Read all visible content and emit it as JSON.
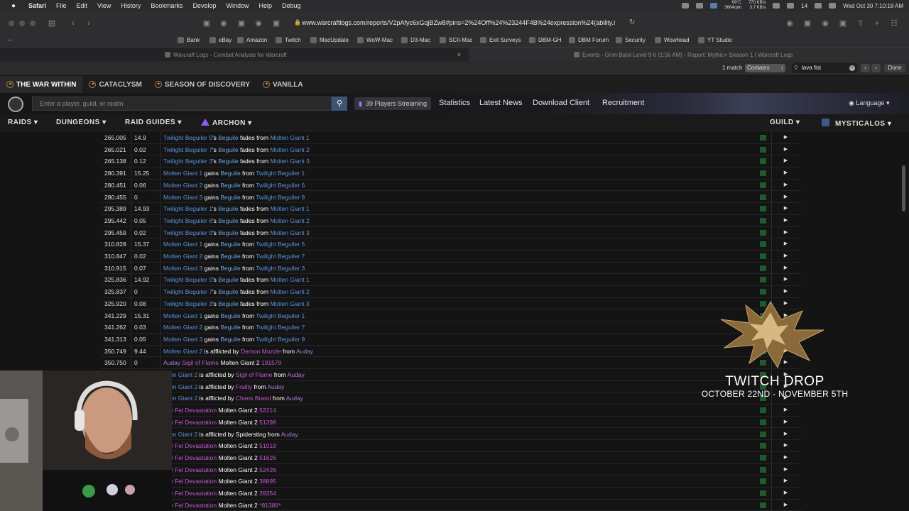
{
  "menubar": {
    "app": "Safari",
    "items": [
      "File",
      "Edit",
      "View",
      "History",
      "Bookmarks",
      "Develop",
      "Window",
      "Help",
      "Debug"
    ],
    "temp": "69°C",
    "rpm": "3664rpm",
    "net_up": "770 KB/s",
    "net_down": "3.7 KB/s",
    "battery_num": "14",
    "clock": "Wed Oct 30  7:10:18 AM"
  },
  "toolbar": {
    "url": "www.warcraftlogs.com/reports/V2pAfyc6xGqjBZw8#pins=2%24Off%24%23244F4B%24expression%24(ability.i"
  },
  "favorites": [
    "Bank",
    "eBay",
    "Amazon",
    "Twitch",
    "MacUpdate",
    "WoW-Mac",
    "D3-Mac",
    "SCII-Mac",
    "Exit Surveys",
    "DBM-GH",
    "DBM Forum",
    "Security",
    "Wowhead",
    "YT Studio"
  ],
  "tabs": {
    "left": "Warcraft Logs - Combat Analysis for Warcraft",
    "right": "Events - Grim Batol Level 9 6 (1:56 AM) - Report: Mythic+ Season 1 | Warcraft Logs"
  },
  "findbar": {
    "matches": "1 match",
    "mode": "Contains",
    "query": "lava fist",
    "done": "Done"
  },
  "site": {
    "game_tabs": [
      "THE WAR WITHIN",
      "CATACLYSM",
      "SEASON OF DISCOVERY",
      "VANILLA"
    ],
    "search_placeholder": "Enter a player, guild, or realm",
    "streaming": "39 Players Streaming",
    "links": [
      "Statistics",
      "Latest News",
      "Download Client",
      "Recruitment"
    ],
    "language": "Language",
    "nav": {
      "raids": "RAIDS",
      "dungeons": "DUNGEONS",
      "raid_guides": "RAID GUIDES",
      "archon": "ARCHON",
      "guild": "GUILD",
      "user": "MYSTICALOS"
    }
  },
  "rows": [
    {
      "time": "265.005",
      "delta": "14.9",
      "parts": [
        [
          "npc",
          "Twilight Beguiler 5"
        ],
        [
          "nm",
          "'s "
        ],
        [
          "aura",
          "Beguile"
        ],
        [
          "nm",
          " fades from "
        ],
        [
          "npc",
          "Molten Giant 1"
        ]
      ]
    },
    {
      "time": "265.021",
      "delta": "0.02",
      "parts": [
        [
          "npc",
          "Twilight Beguiler 7"
        ],
        [
          "nm",
          "'s "
        ],
        [
          "aura",
          "Beguile"
        ],
        [
          "nm",
          " fades from "
        ],
        [
          "npc",
          "Molten Giant 2"
        ]
      ]
    },
    {
      "time": "265.138",
      "delta": "0.12",
      "parts": [
        [
          "npc",
          "Twilight Beguiler 3"
        ],
        [
          "nm",
          "'s "
        ],
        [
          "aura",
          "Beguile"
        ],
        [
          "nm",
          " fades from "
        ],
        [
          "npc",
          "Molten Giant 3"
        ]
      ]
    },
    {
      "time": "280.391",
      "delta": "15.25",
      "parts": [
        [
          "npc",
          "Molten Giant 1"
        ],
        [
          "nm",
          " gains "
        ],
        [
          "aura",
          "Beguile"
        ],
        [
          "nm",
          " from "
        ],
        [
          "npc",
          "Twilight Beguiler 1"
        ]
      ]
    },
    {
      "time": "280.451",
      "delta": "0.06",
      "parts": [
        [
          "npc",
          "Molten Giant 2"
        ],
        [
          "nm",
          " gains "
        ],
        [
          "aura",
          "Beguile"
        ],
        [
          "nm",
          " from "
        ],
        [
          "npc",
          "Twilight Beguiler 6"
        ]
      ]
    },
    {
      "time": "280.455",
      "delta": "0",
      "parts": [
        [
          "npc",
          "Molten Giant 3"
        ],
        [
          "nm",
          " gains "
        ],
        [
          "aura",
          "Beguile"
        ],
        [
          "nm",
          " from "
        ],
        [
          "npc",
          "Twilight Beguiler 9"
        ]
      ]
    },
    {
      "time": "295.389",
      "delta": "14.93",
      "parts": [
        [
          "npc",
          "Twilight Beguiler 1"
        ],
        [
          "nm",
          "'s "
        ],
        [
          "aura",
          "Beguile"
        ],
        [
          "nm",
          " fades from "
        ],
        [
          "npc",
          "Molten Giant 1"
        ]
      ]
    },
    {
      "time": "295.442",
      "delta": "0.05",
      "parts": [
        [
          "npc",
          "Twilight Beguiler 6"
        ],
        [
          "nm",
          "'s "
        ],
        [
          "aura",
          "Beguile"
        ],
        [
          "nm",
          " fades from "
        ],
        [
          "npc",
          "Molten Giant 2"
        ]
      ]
    },
    {
      "time": "295.459",
      "delta": "0.02",
      "parts": [
        [
          "npc",
          "Twilight Beguiler 9"
        ],
        [
          "nm",
          "'s "
        ],
        [
          "aura",
          "Beguile"
        ],
        [
          "nm",
          " fades from "
        ],
        [
          "npc",
          "Molten Giant 3"
        ]
      ]
    },
    {
      "time": "310.828",
      "delta": "15.37",
      "parts": [
        [
          "npc",
          "Molten Giant 1"
        ],
        [
          "nm",
          " gains "
        ],
        [
          "aura",
          "Beguile"
        ],
        [
          "nm",
          " from "
        ],
        [
          "npc",
          "Twilight Beguiler 5"
        ]
      ]
    },
    {
      "time": "310.847",
      "delta": "0.02",
      "parts": [
        [
          "npc",
          "Molten Giant 2"
        ],
        [
          "nm",
          " gains "
        ],
        [
          "aura",
          "Beguile"
        ],
        [
          "nm",
          " from "
        ],
        [
          "npc",
          "Twilight Beguiler 7"
        ]
      ]
    },
    {
      "time": "310.915",
      "delta": "0.07",
      "parts": [
        [
          "npc",
          "Molten Giant 3"
        ],
        [
          "nm",
          " gains "
        ],
        [
          "aura",
          "Beguile"
        ],
        [
          "nm",
          " from "
        ],
        [
          "npc",
          "Twilight Beguiler 3"
        ]
      ]
    },
    {
      "time": "325.836",
      "delta": "14.92",
      "parts": [
        [
          "npc",
          "Twilight Beguiler 5"
        ],
        [
          "nm",
          "'s "
        ],
        [
          "aura",
          "Beguile"
        ],
        [
          "nm",
          " fades from "
        ],
        [
          "npc",
          "Molten Giant 1"
        ]
      ]
    },
    {
      "time": "325.837",
      "delta": "0",
      "parts": [
        [
          "npc",
          "Twilight Beguiler 7"
        ],
        [
          "nm",
          "'s "
        ],
        [
          "aura",
          "Beguile"
        ],
        [
          "nm",
          " fades from "
        ],
        [
          "npc",
          "Molten Giant 2"
        ]
      ]
    },
    {
      "time": "325.920",
      "delta": "0.08",
      "parts": [
        [
          "npc",
          "Twilight Beguiler 3"
        ],
        [
          "nm",
          "'s "
        ],
        [
          "aura",
          "Beguile"
        ],
        [
          "nm",
          " fades from "
        ],
        [
          "npc",
          "Molten Giant 3"
        ]
      ]
    },
    {
      "time": "341.229",
      "delta": "15.31",
      "parts": [
        [
          "npc",
          "Molten Giant 1"
        ],
        [
          "nm",
          " gains "
        ],
        [
          "aura",
          "Beguile"
        ],
        [
          "nm",
          " from "
        ],
        [
          "npc",
          "Twilight Beguiler 1"
        ]
      ]
    },
    {
      "time": "341.262",
      "delta": "0.03",
      "parts": [
        [
          "npc",
          "Molten Giant 2"
        ],
        [
          "nm",
          " gains "
        ],
        [
          "aura",
          "Beguile"
        ],
        [
          "nm",
          " from "
        ],
        [
          "npc",
          "Twilight Beguiler 7"
        ]
      ]
    },
    {
      "time": "341.313",
      "delta": "0.05",
      "parts": [
        [
          "npc",
          "Molten Giant 3"
        ],
        [
          "nm",
          " gains "
        ],
        [
          "aura",
          "Beguile"
        ],
        [
          "nm",
          " from "
        ],
        [
          "npc",
          "Twilight Beguiler 9"
        ]
      ]
    },
    {
      "time": "350.749",
      "delta": "9.44",
      "parts": [
        [
          "npc",
          "Molten Giant 2"
        ],
        [
          "nm",
          " is afflicted by "
        ],
        [
          "ab",
          "Demon Muzzle"
        ],
        [
          "nm",
          " from "
        ],
        [
          "pet",
          "Auday"
        ]
      ]
    },
    {
      "time": "350.750",
      "delta": "0",
      "parts": [
        [
          "pet",
          "Auday "
        ],
        [
          "ab",
          "Sigil of Flame"
        ],
        [
          "nm",
          " Molten Giant 2 "
        ],
        [
          "num",
          "191579"
        ]
      ]
    },
    {
      "time": "",
      "delta": "",
      "parts": [
        [
          "npc",
          "olten Giant 2"
        ],
        [
          "nm",
          " is afflicted by "
        ],
        [
          "ab",
          "Sigil of Flame"
        ],
        [
          "nm",
          " from "
        ],
        [
          "pet",
          "Auday"
        ]
      ]
    },
    {
      "time": "",
      "delta": "",
      "parts": [
        [
          "npc",
          "olten Giant 2"
        ],
        [
          "nm",
          " is afflicted by "
        ],
        [
          "ab",
          "Frailty"
        ],
        [
          "nm",
          " from "
        ],
        [
          "pet",
          "Auday"
        ]
      ]
    },
    {
      "time": "",
      "delta": "",
      "parts": [
        [
          "npc",
          "olten Giant 2"
        ],
        [
          "nm",
          " is afflicted by "
        ],
        [
          "ab",
          "Chaos Brand"
        ],
        [
          "nm",
          " from "
        ],
        [
          "pet",
          "Auday"
        ]
      ]
    },
    {
      "time": "",
      "delta": "",
      "parts": [
        [
          "pet",
          "day "
        ],
        [
          "ab",
          "Fel Devastation"
        ],
        [
          "nm",
          " Molten Giant 2 "
        ],
        [
          "num",
          "52214"
        ]
      ]
    },
    {
      "time": "",
      "delta": "",
      "parts": [
        [
          "pet",
          "day "
        ],
        [
          "ab",
          "Fel Devastation"
        ],
        [
          "nm",
          " Molten Giant 2 "
        ],
        [
          "num",
          "51398"
        ]
      ]
    },
    {
      "time": "",
      "delta": "",
      "parts": [
        [
          "npc",
          "olten Giant 2"
        ],
        [
          "nm",
          " is afflicted by "
        ],
        [
          "nm",
          "Spidersting"
        ],
        [
          "nm",
          " from "
        ],
        [
          "pet",
          "Auday"
        ]
      ]
    },
    {
      "time": "",
      "delta": "",
      "parts": [
        [
          "pet",
          "day "
        ],
        [
          "ab",
          "Fel Devastation"
        ],
        [
          "nm",
          " Molten Giant 2 "
        ],
        [
          "num",
          "51019"
        ]
      ]
    },
    {
      "time": "",
      "delta": "",
      "parts": [
        [
          "pet",
          "day "
        ],
        [
          "ab",
          "Fel Devastation"
        ],
        [
          "nm",
          " Molten Giant 2 "
        ],
        [
          "num",
          "51626"
        ]
      ]
    },
    {
      "time": "",
      "delta": "",
      "parts": [
        [
          "pet",
          "day "
        ],
        [
          "ab",
          "Fel Devastation"
        ],
        [
          "nm",
          " Molten Giant 2 "
        ],
        [
          "num",
          "52426"
        ]
      ]
    },
    {
      "time": "",
      "delta": "",
      "parts": [
        [
          "pet",
          "day "
        ],
        [
          "ab",
          "Fel Devastation"
        ],
        [
          "nm",
          " Molten Giant 2 "
        ],
        [
          "num",
          "38895"
        ]
      ]
    },
    {
      "time": "",
      "delta": "",
      "parts": [
        [
          "pet",
          "day "
        ],
        [
          "ab",
          "Fel Devastation"
        ],
        [
          "nm",
          " Molten Giant 2 "
        ],
        [
          "num",
          "39354"
        ]
      ]
    },
    {
      "time": "",
      "delta": "",
      "parts": [
        [
          "pet",
          "day "
        ],
        [
          "ab",
          "Fel Devastation"
        ],
        [
          "nm",
          " Molten Giant 2 "
        ],
        [
          "num",
          "*81389*"
        ]
      ]
    }
  ],
  "overlay": {
    "title": "TWITCH DROP",
    "subtitle": "OCTOBER 22ND - NOVEMBER 5TH"
  },
  "colors": {
    "npc": "#5b92dc",
    "aura": "#6ba3e3",
    "pet": "#a87dd8",
    "ability": "#c25ad0",
    "accent_search": "#3d5575",
    "archon": "#8a5cf0"
  }
}
